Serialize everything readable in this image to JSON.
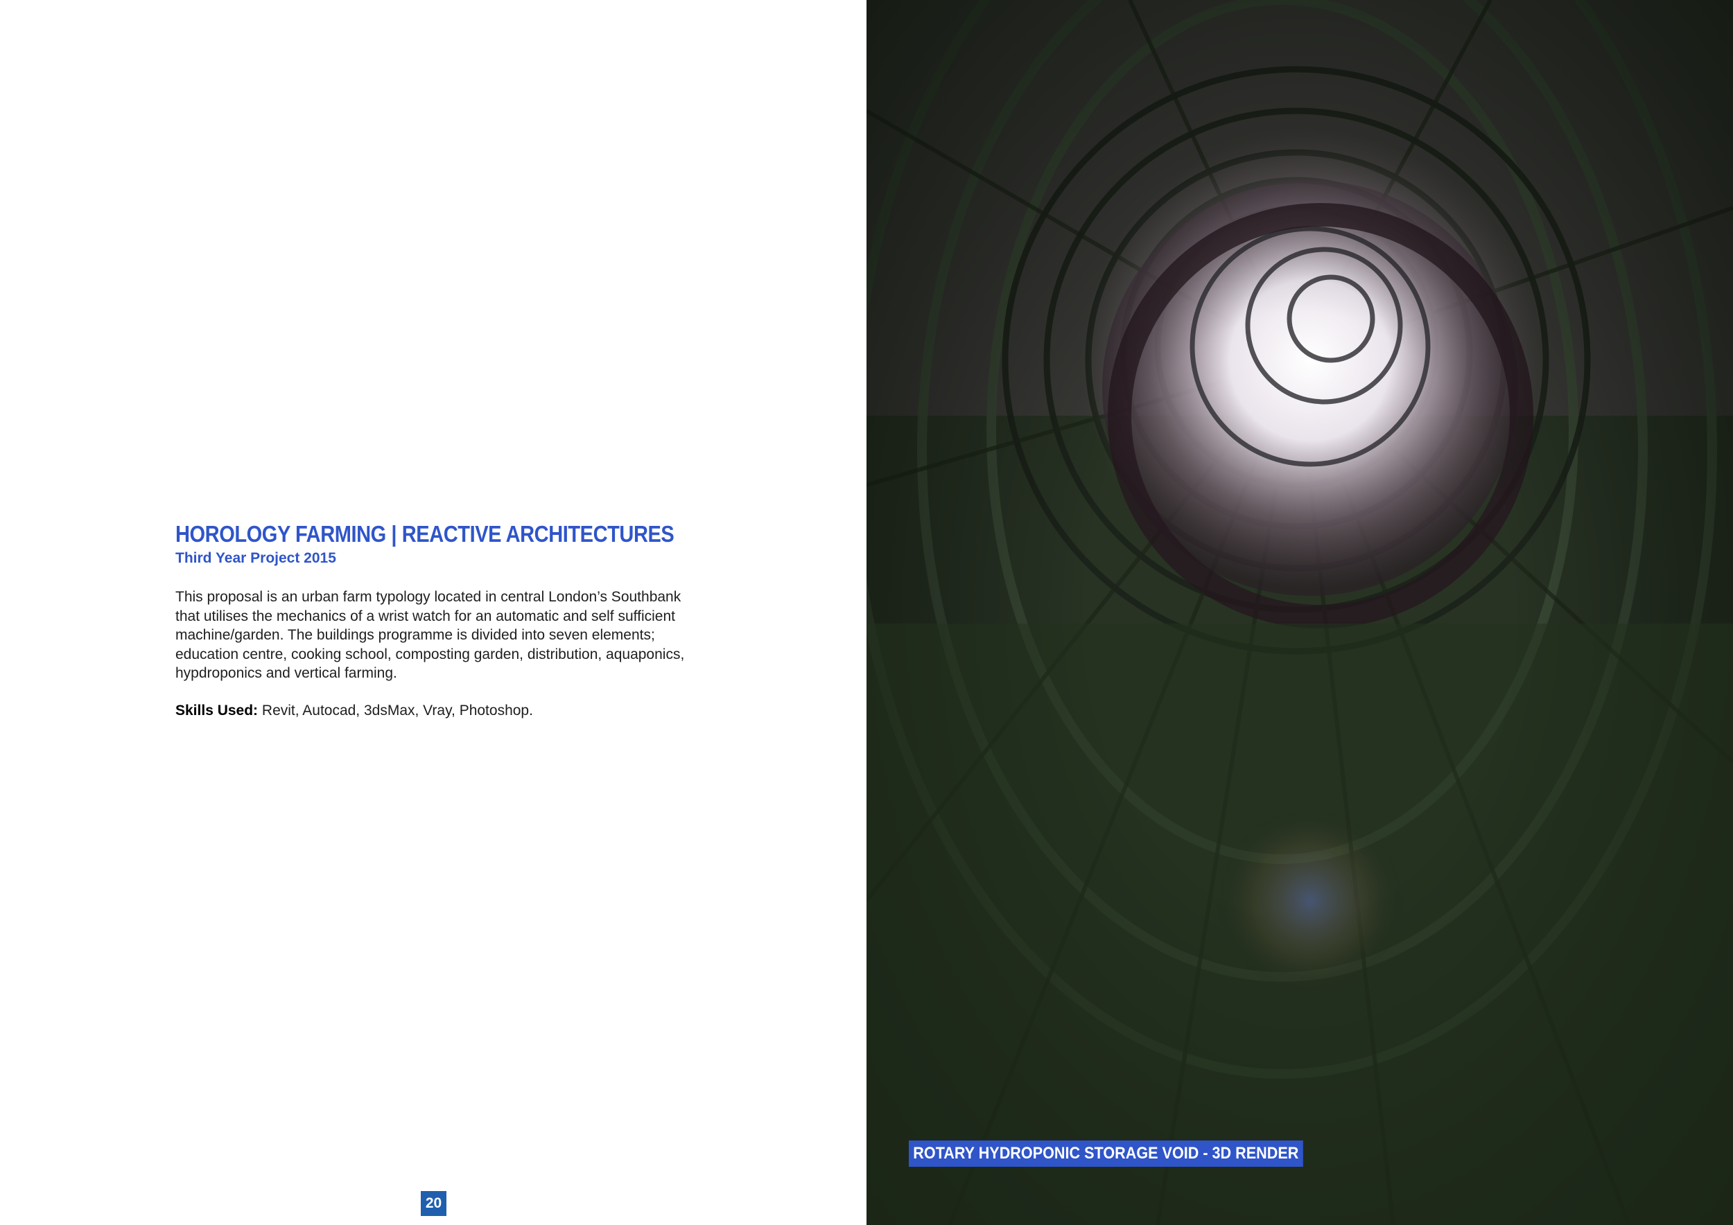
{
  "left_page": {
    "title": "HOROLOGY FARMING | REACTIVE ARCHITECTURES",
    "subtitle": "Third Year Project 2015",
    "description": "This proposal is an urban farm typology located in central London’s Southbank that utilises the mechanics of a wrist watch for an automatic and self sufficient machine/garden. The buildings programme is divided into seven elements; education centre, cooking school, composting garden, distribution, aquaponics, hypdroponics and vertical farming.",
    "skills_label": "Skills Used:",
    "skills_value": " Revit, Autocad, 3dsMax, Vray, Photoshop.",
    "page_number": "20"
  },
  "right_page": {
    "caption": "ROTARY HYDROPONIC STORAGE VOID - 3D RENDER"
  },
  "colors": {
    "accent_blue": "#2f55c9",
    "page_number_bg": "#1f5fae"
  }
}
